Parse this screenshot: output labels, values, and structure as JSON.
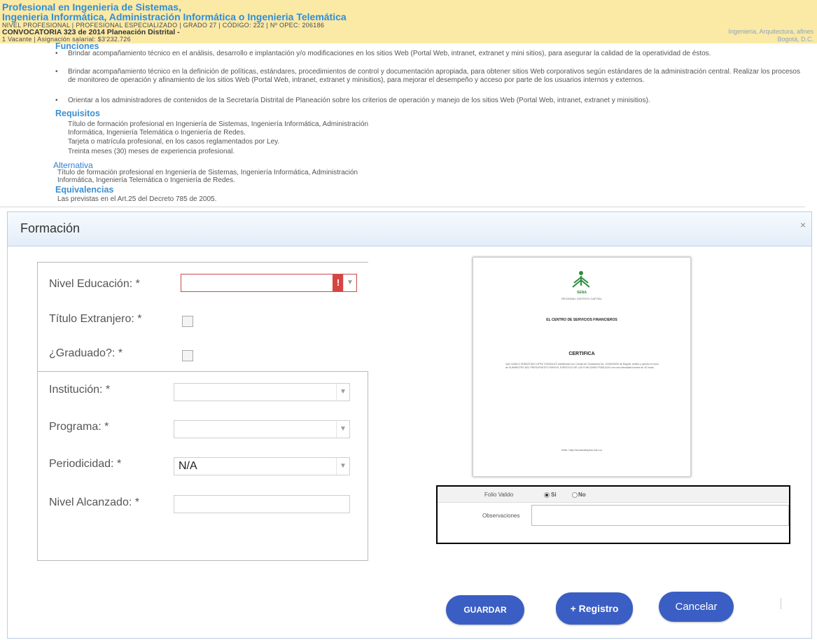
{
  "job": {
    "title1": "Profesional en Ingenieria de Sistemas,",
    "title2": "Ingenieria Informática, Administración Informática o Ingenieria Telemática",
    "meta": "NIVEL PROFESIONAL  |  PROFESIONAL ESPECIALIZADO  |  GRADO 27  |  CÓDIGO: 222  |  Nº OPEC: 206186",
    "convocatoria": "CONVOCATORIA 323 de 2014 Planeación Distrital -",
    "vacante": "1 Vacante  |  Asignación salarial: $3'232.726",
    "right1": "Ingenieria, Arquitectura, afines",
    "right2": "Bogotá, D.C."
  },
  "funciones": {
    "title": "Funciones",
    "items": [
      "Brindar acompañamiento técnico en el análisis, desarrollo e implantación y/o modificaciones en los sitios Web (Portal Web, intranet, extranet y mini sitios), para asegurar la calidad de la operatividad de éstos.",
      "Brindar acompañamiento técnico en la definición de políticas, estándares, procedimientos de control y documentación apropiada, para obtener sitios Web corporativos según estándares de la administración central. Realizar los procesos de monitoreo de operación y afinamiento de los sitios Web (Portal Web, intranet, extranet y minisitios), para mejorar el desempeño y acceso por parte de los usuarios internos y externos.",
      "Orientar a los administradores de contenidos de la Secretaría Distrital de Planeación sobre los criterios de operación y manejo de los sitios Web (Portal Web, intranet, extranet y minisitios)."
    ]
  },
  "requisitos": {
    "title": "Requisitos",
    "lines": [
      "Título de formación profesional en Ingeniería de Sistemas, Ingeniería Informática, Administración",
      "Informática, Ingeniería Telemática o Ingeniería de Redes.",
      "Tarjeta o matrícula profesional, en los casos reglamentados por Ley.",
      "Treinta meses (30) meses de experiencia profesional."
    ]
  },
  "alternativa": {
    "title": "Alternativa",
    "lines": [
      "Título de formación profesional en Ingeniería de Sistemas, Ingeniería Informática, Administración",
      "Informática, Ingeniería Telemática o Ingeniería de Redes."
    ]
  },
  "equivalencias": {
    "title": "Equivalencias",
    "text": "Las previstas en el Art.25 del Decreto 785 de 2005."
  },
  "modal": {
    "title": "Formación",
    "close": "×"
  },
  "form": {
    "nivel_educacion": "Nivel Educación: *",
    "titulo_extranjero": "Título Extranjero: *",
    "graduado": "¿Graduado?: *",
    "institucion": "Institución: *",
    "programa": "Programa: *",
    "periodicidad": "Periodicidad: *",
    "periodicidad_value": "N/A",
    "nivel_alcanzado": "Nivel Alcanzado: *",
    "error_icon": "!"
  },
  "certificate": {
    "org": "SENA",
    "region": "REGIONAL DISTRITO CAPITAL",
    "center": "EL CENTRO DE SERVICIOS FINANCIEROS",
    "heading": "CERTIFICA",
    "body": "Que CAMILO SEBASTIAN LOPEZ GONZALEZ identificado con Cédula de Ciudadanía No. 1016000000 de Bogotá, realizó y aprobó el curso de SUMINISTRO DEL PRESUPUESTO PARA EL EJERCICIO DE LAS FUNCIONES PÚBLICAS con una intensidad horaria de 40 horas.",
    "footer": "Web: http://senasofiaplus.edu.co"
  },
  "folio": {
    "label": "Folio Valido",
    "opt_si": "Si",
    "opt_no": "No",
    "observaciones": "Observaciones"
  },
  "buttons": {
    "guardar": "GUARDAR",
    "registro": "+ Registro",
    "cancelar": "Cancelar"
  },
  "colors": {
    "header_bg": "#fbe9a6",
    "link_blue": "#2f8ed6",
    "button_blue": "#3a5ec3",
    "error_red": "#d6453f"
  }
}
